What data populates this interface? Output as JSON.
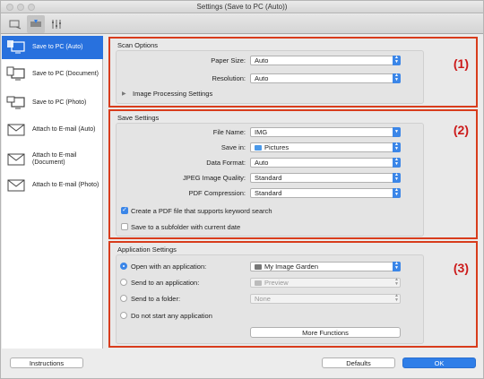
{
  "window": {
    "title": "Settings (Save to PC (Auto))"
  },
  "toolbar": {
    "tabs": [
      "scan-from-pc-icon",
      "scan-from-operation-panel-icon",
      "general-settings-icon"
    ]
  },
  "sidebar": {
    "items": [
      {
        "label": "Save to PC (Auto)",
        "icon": "save-to-pc-auto-icon"
      },
      {
        "label": "Save to PC (Document)",
        "icon": "save-to-pc-document-icon"
      },
      {
        "label": "Save to PC (Photo)",
        "icon": "save-to-pc-photo-icon"
      },
      {
        "label": "Attach to E-mail (Auto)",
        "icon": "mail-icon"
      },
      {
        "label": "Attach to E-mail (Document)",
        "icon": "mail-document-icon"
      },
      {
        "label": "Attach to E-mail (Photo)",
        "icon": "mail-photo-icon"
      }
    ]
  },
  "scan_options": {
    "title": "Scan Options",
    "number": "(1)",
    "paper_size_label": "Paper Size:",
    "paper_size_value": "Auto",
    "resolution_label": "Resolution:",
    "resolution_value": "Auto",
    "image_processing_label": "Image Processing Settings"
  },
  "save_settings": {
    "title": "Save Settings",
    "number": "(2)",
    "file_name_label": "File Name:",
    "file_name_value": "IMG",
    "save_in_label": "Save in:",
    "save_in_value": "Pictures",
    "data_format_label": "Data Format:",
    "data_format_value": "Auto",
    "jpeg_quality_label": "JPEG Image Quality:",
    "jpeg_quality_value": "Standard",
    "pdf_compression_label": "PDF Compression:",
    "pdf_compression_value": "Standard",
    "keyword_search_label": "Create a PDF file that supports keyword search",
    "subfolder_label": "Save to a subfolder with current date"
  },
  "application_settings": {
    "title": "Application Settings",
    "number": "(3)",
    "open_with_label": "Open with an application:",
    "open_with_value": "My Image Garden",
    "send_to_app_label": "Send to an application:",
    "send_to_app_value": "Preview",
    "send_to_folder_label": "Send to a folder:",
    "send_to_folder_value": "None",
    "do_not_start_label": "Do not start any application",
    "more_functions_label": "More Functions"
  },
  "footer": {
    "instructions_label": "Instructions",
    "defaults_label": "Defaults",
    "ok_label": "OK"
  },
  "colors": {
    "accent": "#2f7ee8",
    "highlight": "#d83c1c",
    "number": "#cc1a1a"
  }
}
